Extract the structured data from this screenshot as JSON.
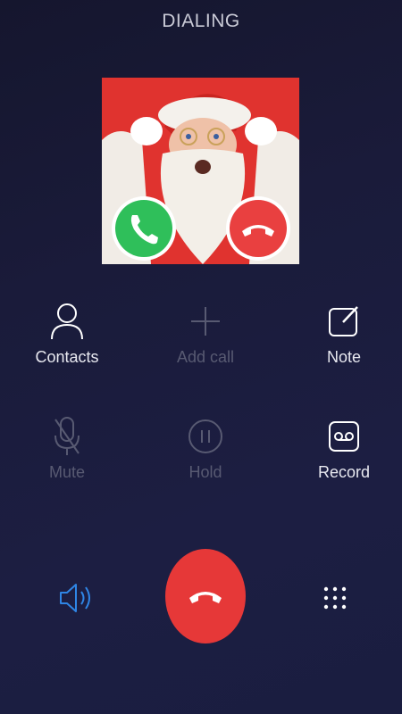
{
  "call": {
    "status": "DIALING"
  },
  "actions": {
    "contacts": "Contacts",
    "add_call": "Add call",
    "note": "Note",
    "mute": "Mute",
    "hold": "Hold",
    "record": "Record"
  },
  "colors": {
    "end_call": "#e63838",
    "speaker": "#2f86e6",
    "answer": "#2fbf5a",
    "enabled_text": "#e8e9f0",
    "disabled_text": "#585a72"
  }
}
